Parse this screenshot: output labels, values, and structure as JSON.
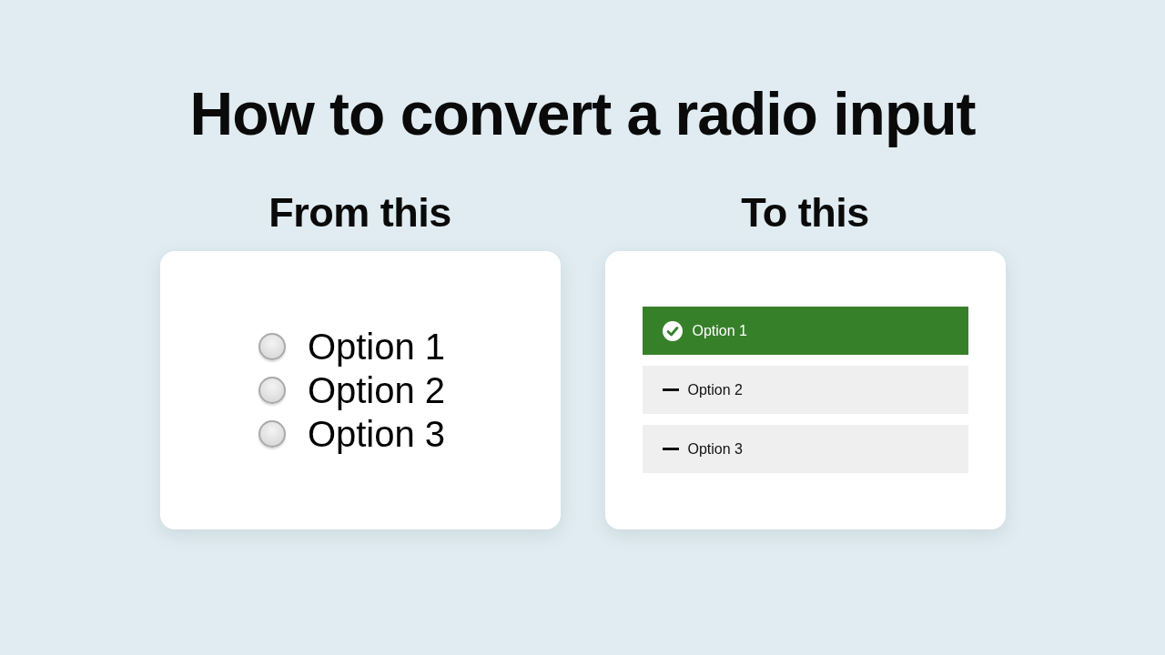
{
  "title": "How to convert a radio input",
  "from_panel": {
    "heading": "From this",
    "options": [
      {
        "label": "Option 1",
        "selected": false
      },
      {
        "label": "Option 2",
        "selected": false
      },
      {
        "label": "Option 3",
        "selected": false
      }
    ]
  },
  "to_panel": {
    "heading": "To this",
    "options": [
      {
        "label": "Option 1",
        "selected": true
      },
      {
        "label": "Option 2",
        "selected": false
      },
      {
        "label": "Option 3",
        "selected": false
      }
    ]
  }
}
